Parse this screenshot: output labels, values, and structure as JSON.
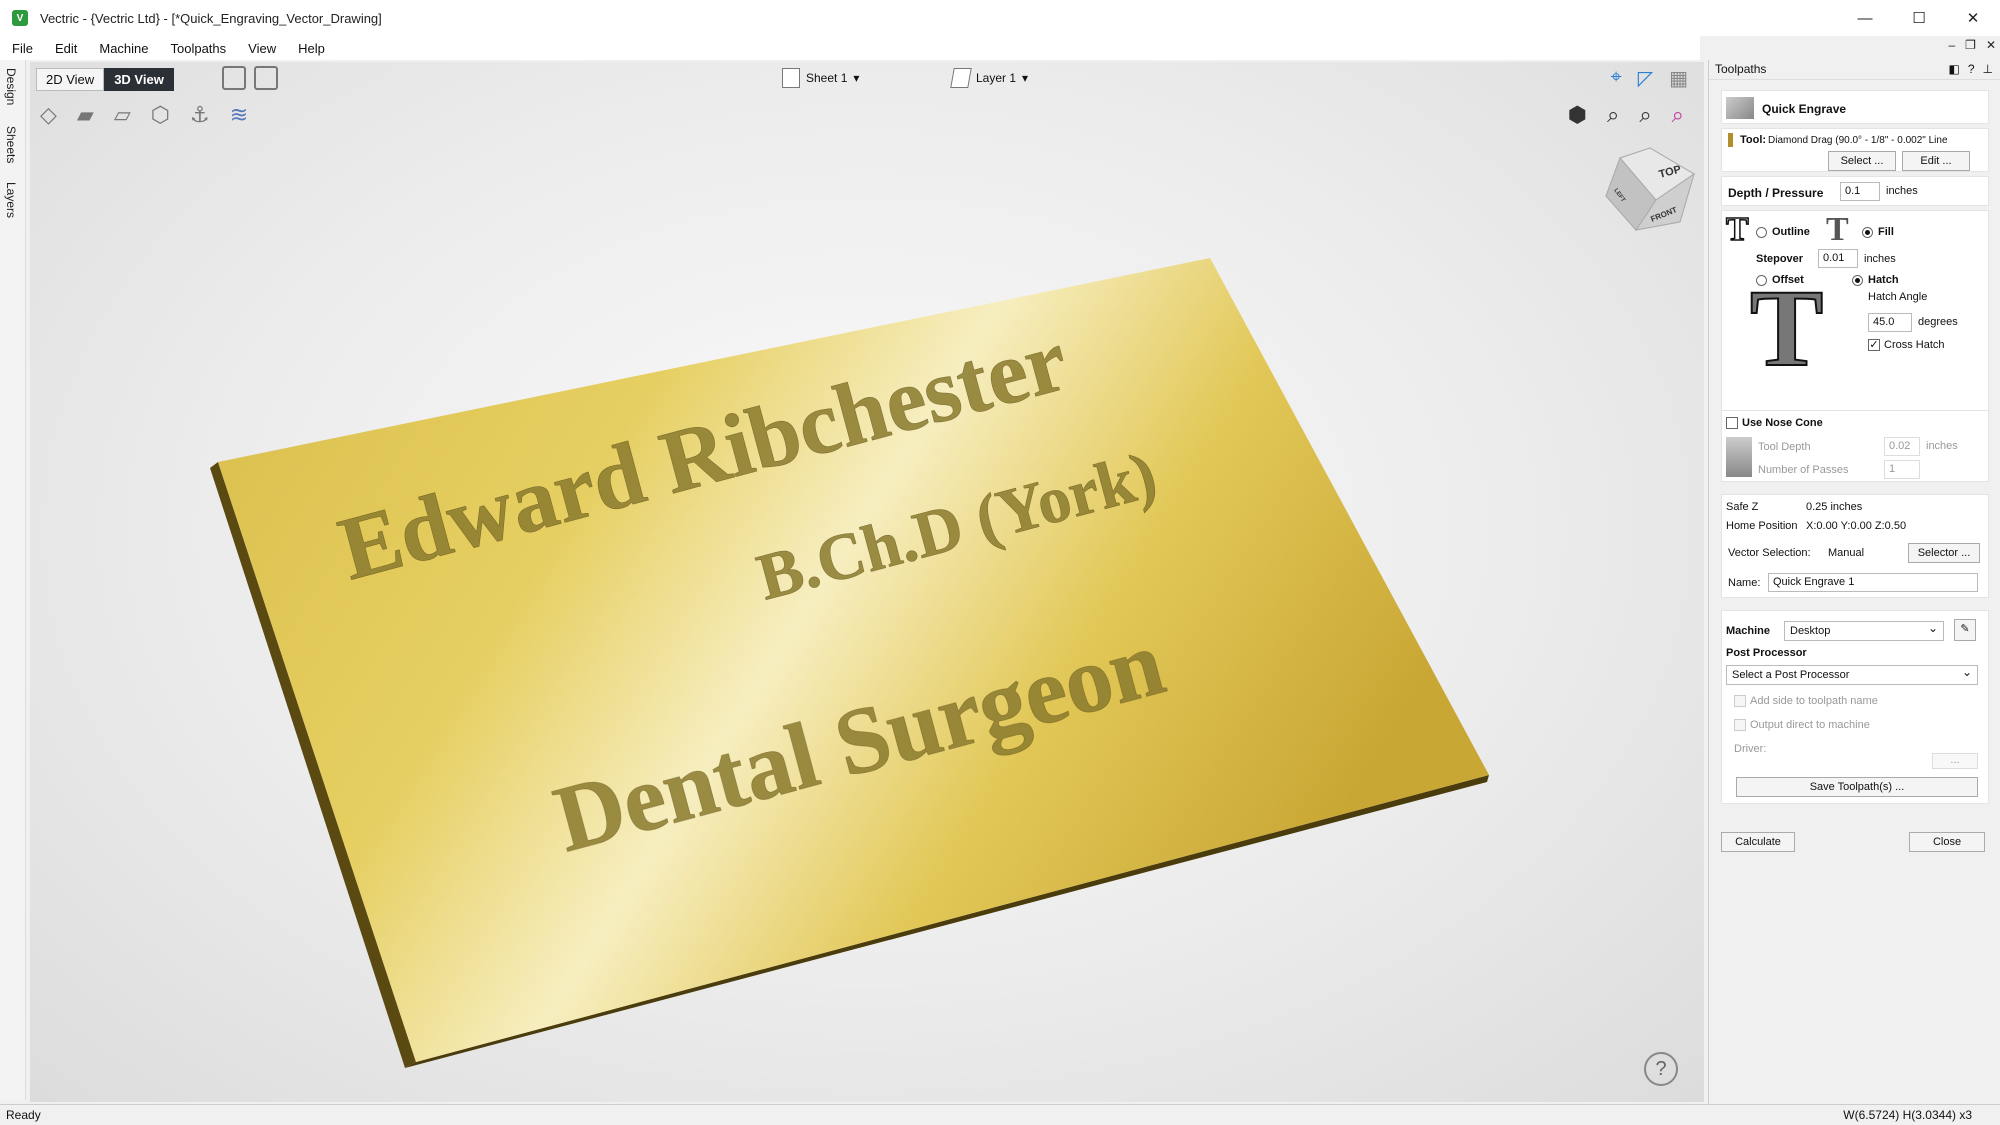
{
  "window": {
    "title": "Vectric - {Vectric Ltd} - [*Quick_Engraving_Vector_Drawing]",
    "app_icon": "V",
    "minimize": "—",
    "maximize": "☐",
    "close": "✕"
  },
  "mdi": {
    "minimize": "–",
    "restore": "❐",
    "close": "✕"
  },
  "menu": [
    "File",
    "Edit",
    "Machine",
    "Toolpaths",
    "View",
    "Help"
  ],
  "sidetabs": [
    "Design",
    "Sheets",
    "Layers"
  ],
  "viewport": {
    "view_2d": "2D View",
    "view_3d": "3D View",
    "sheet": "Sheet 1",
    "layer": "Layer 1",
    "help": "?"
  },
  "cube": {
    "top": "TOP",
    "front": "FRONT",
    "left": "LEFT"
  },
  "plaque": {
    "line1": "Edward Ribchester",
    "line2": "B.Ch.D (York)",
    "line3": "Dental Surgeon"
  },
  "status": {
    "left": "Ready",
    "right": "W(6.5724) H(3.0344) x3"
  },
  "panel": {
    "header": "Toolpaths",
    "title": "Quick Engrave",
    "tool_label": "Tool:",
    "tool_value": "Diamond Drag (90.0° - 1/8\" - 0.002\" Line",
    "select_btn": "Select ...",
    "edit_btn": "Edit ...",
    "depth_label": "Depth / Pressure",
    "depth_value": "0.1",
    "depth_unit": "inches",
    "outline_label": "Outline",
    "fill_label": "Fill",
    "stepover_label": "Stepover",
    "stepover_value": "0.01",
    "stepover_unit": "inches",
    "offset_label": "Offset",
    "hatch_label": "Hatch",
    "hatch_angle_label": "Hatch Angle",
    "hatch_angle_value": "45.0",
    "hatch_angle_unit": "degrees",
    "cross_hatch_label": "Cross Hatch",
    "nose_cone_label": "Use Nose Cone",
    "tool_depth_label": "Tool Depth",
    "tool_depth_value": "0.02",
    "tool_depth_unit": "inches",
    "passes_label": "Number of Passes",
    "passes_value": "1",
    "safez_label": "Safe Z",
    "safez_value": "0.25 inches",
    "home_label": "Home Position",
    "home_value": "X:0.00 Y:0.00 Z:0.50",
    "vector_sel_label": "Vector Selection:",
    "vector_sel_value": "Manual",
    "selector_btn": "Selector ...",
    "name_label": "Name:",
    "name_value": "Quick Engrave 1",
    "machine_label": "Machine",
    "machine_value": "Desktop",
    "post_label": "Post Processor",
    "post_placeholder": "Select a Post Processor",
    "add_side_label": "Add side to toolpath name",
    "output_direct_label": "Output direct to machine",
    "driver_label": "Driver:",
    "driver_btn": "...",
    "save_btn": "Save Toolpath(s) ...",
    "calculate_btn": "Calculate",
    "close_btn": "Close",
    "T_glyph": "T"
  }
}
